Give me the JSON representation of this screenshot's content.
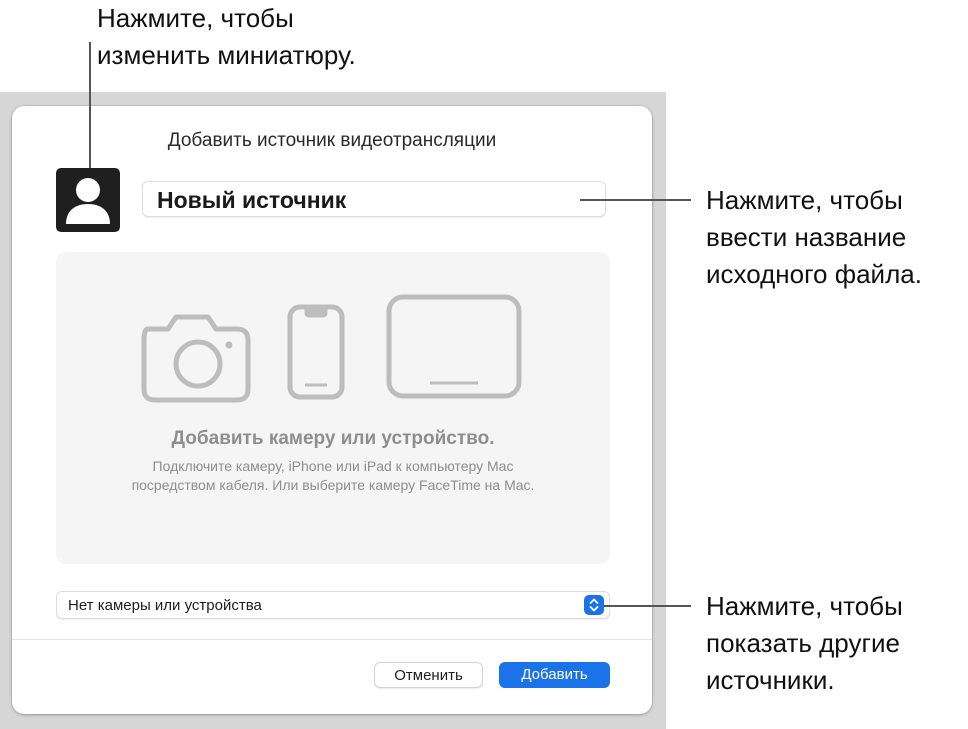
{
  "dialog": {
    "title": "Добавить источник видеотрансляции",
    "source_name": "Новый источник",
    "drop_area": {
      "heading": "Добавить камеру или устройство.",
      "description_line1": "Подключите камеру, iPhone или iPad к компьютеру Mac",
      "description_line2": "посредством кабеля. Или выберите камеру FaceTime на Mac."
    },
    "source_select": {
      "value": "Нет камеры или устройства"
    },
    "buttons": {
      "cancel": "Отменить",
      "add": "Добавить"
    }
  },
  "callouts": {
    "thumbnail": {
      "line1": "Нажмите, чтобы",
      "line2": "изменить миниатюру."
    },
    "name": {
      "line1": "Нажмите, чтобы",
      "line2": "ввести название",
      "line3": "исходного файла."
    },
    "sources": {
      "line1": "Нажмите, чтобы",
      "line2": "показать другие",
      "line3": "источники."
    }
  },
  "icons": [
    "person-icon",
    "camera-icon",
    "iphone-icon",
    "ipad-icon",
    "chevron-updown-icon"
  ],
  "colors": {
    "accent": "#1a73e8",
    "drop_area_bg": "#f5f5f5",
    "muted_text": "#8e8e8e"
  }
}
